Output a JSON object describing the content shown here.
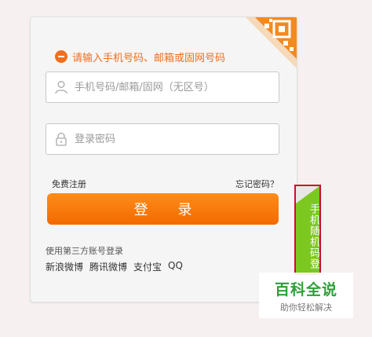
{
  "login": {
    "error_message": "请输入手机号码、邮箱或固网号码",
    "username_placeholder": "手机号码/邮箱/固网（无区号）",
    "password_placeholder": "登录密码",
    "register_link": "免费注册",
    "forgot_link": "忘记密码？",
    "submit_label": "登录"
  },
  "third_party": {
    "title": "使用第三方账号登录",
    "providers": [
      "新浪微博",
      "腾讯微博",
      "支付宝",
      "QQ"
    ]
  },
  "side_tab": {
    "label": "手机随机码登"
  },
  "watermark": {
    "title": "百科全说",
    "subtitle": "助你轻松解决"
  },
  "colors": {
    "accent": "#f26a00",
    "error": "#f16e1e",
    "side_tab": "#7cc820",
    "side_border": "#c8102e"
  },
  "icons": [
    "error-icon",
    "user-icon",
    "lock-icon",
    "qr-code-icon"
  ]
}
